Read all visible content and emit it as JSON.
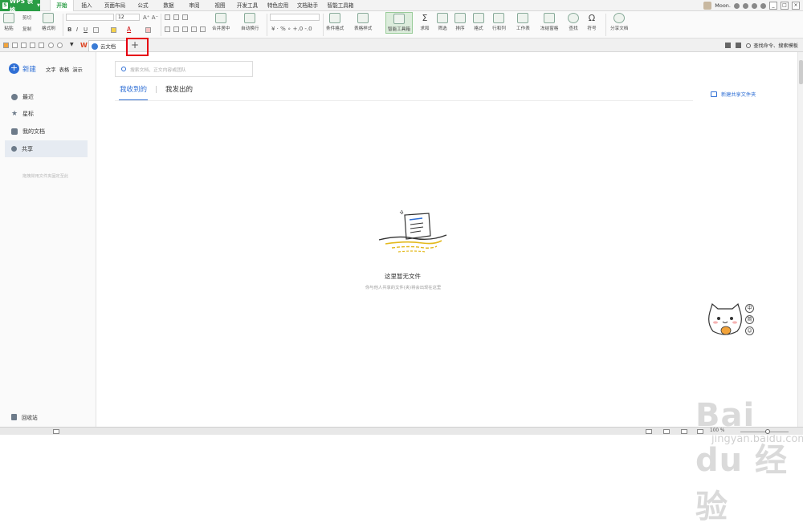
{
  "app": {
    "name": "WPS 表格"
  },
  "menu": [
    "开始",
    "插入",
    "页面布局",
    "公式",
    "数据",
    "审阅",
    "视图",
    "开发工具",
    "特色应用",
    "文档助手",
    "智能工具箱"
  ],
  "user": {
    "name": "Moon."
  },
  "ribbon": {
    "paste": "粘贴",
    "cut": "剪切",
    "copy": "复制",
    "format_painter": "格式刷",
    "font_size": "12",
    "merge_center": "合并居中",
    "wrap_text": "自动换行",
    "conditional_format": "条件格式",
    "table_style": "表格样式",
    "smart_toolbox": "智能工具箱",
    "sum": "求和",
    "filter": "筛选",
    "sort": "排序",
    "format": "格式",
    "row_col": "行和列",
    "worksheet": "工作表",
    "freeze": "冻结窗格",
    "find": "查找",
    "symbol": "符号",
    "share_doc": "分享文档"
  },
  "tabbar": {
    "doc_tab": "云文档",
    "add_tab": "+",
    "search_cmd": "查找命令、搜索模板"
  },
  "sidebar": {
    "new_label": "新建",
    "new_types": [
      "文字",
      "表格",
      "演示"
    ],
    "items": [
      "最近",
      "星标",
      "我的文档",
      "共享"
    ],
    "hint": "拖拽常用文件夹固定至此",
    "recycle": "回收站"
  },
  "main": {
    "search_placeholder": "搜索文档、正文内容或团队",
    "tabs": [
      "我收到的",
      "我发出的"
    ],
    "new_share_folder": "新建共享文件夹",
    "empty_title": "这里暂无文件",
    "empty_sub": "你与他人共享的文件(夹)将会出现在这里"
  },
  "assistant": {
    "buttons": [
      "中",
      "简",
      "☺"
    ]
  },
  "watermark": {
    "brand": "Bai du 经验",
    "url": "jingyan.baidu.com"
  },
  "status": {
    "zoom": "100 %"
  },
  "colors": {
    "accent": "#2f6fd5",
    "brand_green": "#2a9d45",
    "highlight": "#e60012"
  }
}
